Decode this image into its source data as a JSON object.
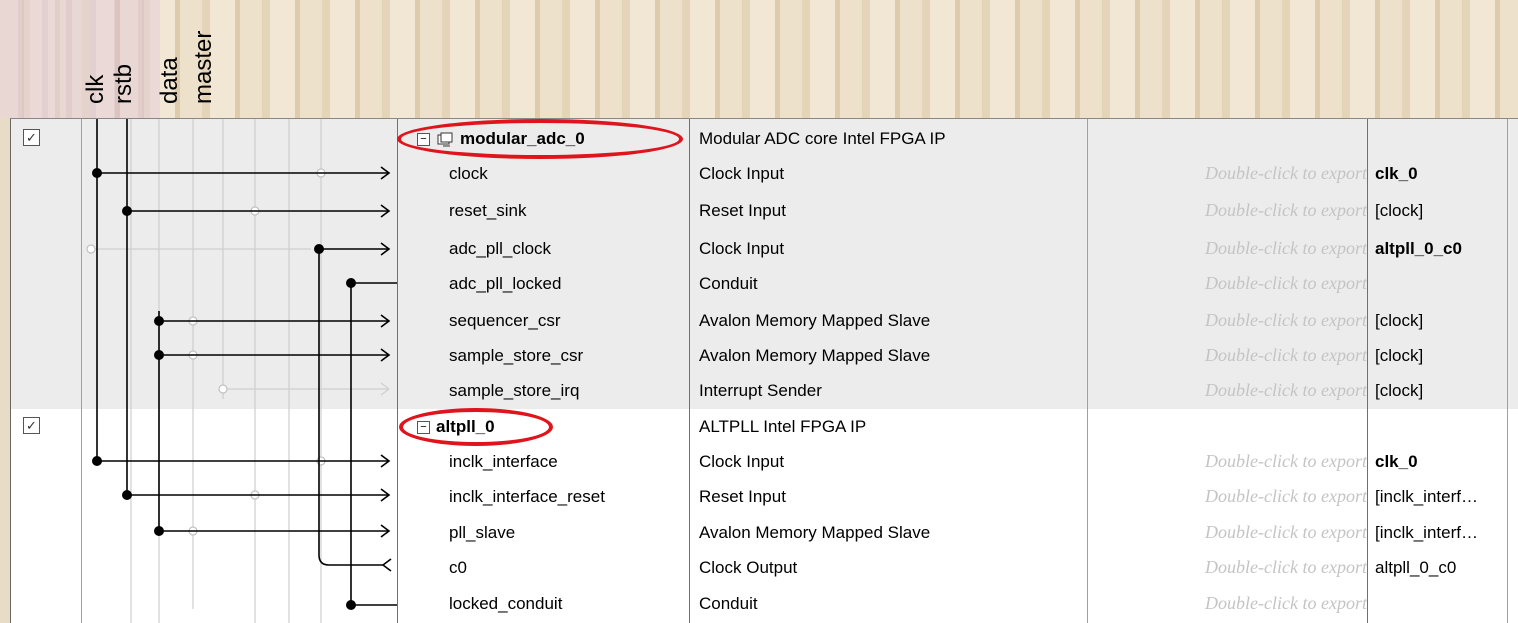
{
  "column_labels": [
    "clk",
    "rstb",
    "data",
    "master"
  ],
  "export_hint": "Double-click to export",
  "components": [
    {
      "name": "modular_adc_0",
      "description": "Modular ADC core Intel FPGA IP",
      "enabled": true,
      "interfaces": [
        {
          "name": "clock",
          "description": "Clock Input",
          "export": "Double-click to export",
          "clock": "clk_0"
        },
        {
          "name": "reset_sink",
          "description": "Reset Input",
          "export": "Double-click to export",
          "clock": "[clock]"
        },
        {
          "name": "adc_pll_clock",
          "description": "Clock Input",
          "export": "Double-click to export",
          "clock": "altpll_0_c0"
        },
        {
          "name": "adc_pll_locked",
          "description": "Conduit",
          "export": "Double-click to export",
          "clock": ""
        },
        {
          "name": "sequencer_csr",
          "description": "Avalon Memory Mapped Slave",
          "export": "Double-click to export",
          "clock": "[clock]"
        },
        {
          "name": "sample_store_csr",
          "description": "Avalon Memory Mapped Slave",
          "export": "Double-click to export",
          "clock": "[clock]"
        },
        {
          "name": "sample_store_irq",
          "description": "Interrupt Sender",
          "export": "Double-click to export",
          "clock": "[clock]"
        }
      ]
    },
    {
      "name": "altpll_0",
      "description": "ALTPLL Intel FPGA IP",
      "enabled": true,
      "interfaces": [
        {
          "name": "inclk_interface",
          "description": "Clock Input",
          "export": "Double-click to export",
          "clock": "clk_0"
        },
        {
          "name": "inclk_interface_reset",
          "description": "Reset Input",
          "export": "Double-click to export",
          "clock": "[inclk_interf…"
        },
        {
          "name": "pll_slave",
          "description": "Avalon Memory Mapped Slave",
          "export": "Double-click to export",
          "clock": "[inclk_interf…"
        },
        {
          "name": "c0",
          "description": "Clock Output",
          "export": "Double-click to export",
          "clock": "altpll_0_c0"
        },
        {
          "name": "locked_conduit",
          "description": "Conduit",
          "export": "Double-click to export",
          "clock": ""
        }
      ]
    }
  ],
  "colors": {
    "highlight_ring": "#e0141c",
    "group_bg": "#ececec",
    "export_text": "#c4c4c4"
  },
  "icons": {
    "expander": "minus-box-icon",
    "component": "component-chip-icon",
    "checkbox": "checkmark-icon"
  }
}
